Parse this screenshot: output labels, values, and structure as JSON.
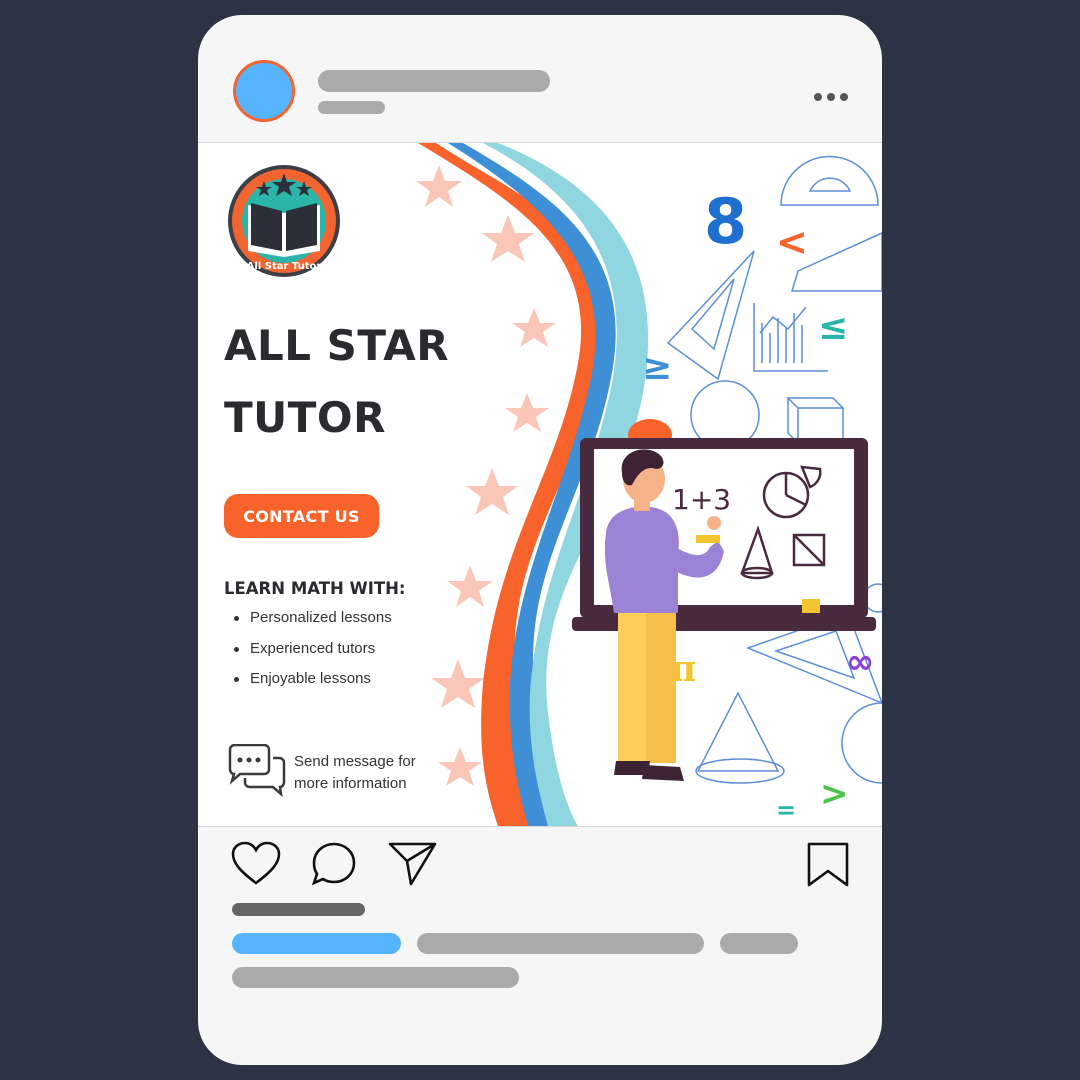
{
  "post": {
    "brand_logo_text": "All Star Tutor",
    "title_line1": "ALL STAR",
    "title_line2": "TUTOR",
    "cta_label": "CONTACT US",
    "learn_heading": "LEARN MATH WITH:",
    "bullets": [
      "Personalized lessons",
      "Experienced tutors",
      "Enjoyable lessons"
    ],
    "message_line1": "Send message for",
    "message_line2": "more information",
    "board_text": "1+3"
  },
  "icons": {
    "more": "more-horizontal-icon",
    "like": "heart-icon",
    "comment": "comment-bubble-icon",
    "share": "paper-plane-icon",
    "save": "bookmark-icon",
    "message": "chat-bubbles-icon"
  },
  "colors": {
    "background": "#2c3345",
    "card": "#f6f6f6",
    "accent_orange": "#f7632a",
    "avatar_blue": "#56b4ff",
    "placeholder_gray": "#aaaaaa",
    "wave_teal": "#8fd6e0",
    "wave_blue": "#3f8fd6",
    "star_pink": "#f9c6b8"
  }
}
